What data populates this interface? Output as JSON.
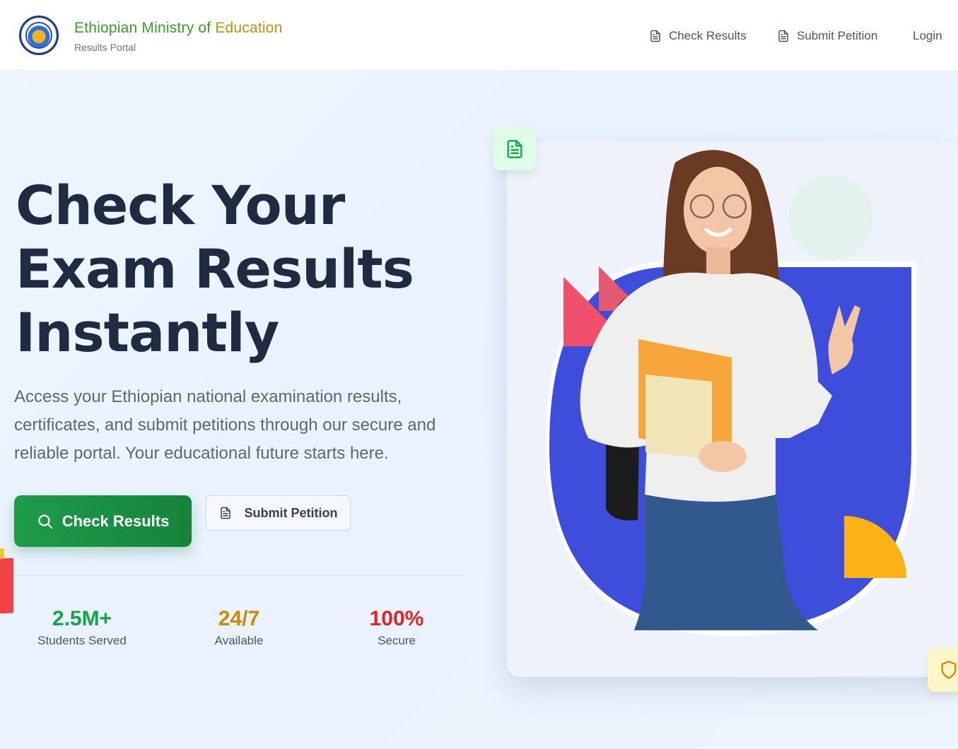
{
  "header": {
    "brand_title_main": "Ethiopian Ministry of",
    "brand_title_tail": " Education",
    "brand_subtitle": "Results Portal",
    "nav": {
      "check_results": "Check Results",
      "submit_petition": "Submit Petition",
      "login": "Login"
    }
  },
  "hero": {
    "title_lines": [
      "Check Your",
      "Exam Results",
      "Instantly"
    ],
    "description": "Access your Ethiopian national examination results, certificates, and submit petitions through our secure and reliable portal. Your educational future starts here.",
    "primary_button": "Check Results",
    "secondary_button": "Submit Petition"
  },
  "stats": [
    {
      "value": "2.5M+",
      "label": "Students Served",
      "color": "#16a34a"
    },
    {
      "value": "24/7",
      "label": "Available",
      "color": "#ca8a04"
    },
    {
      "value": "100%",
      "label": "Secure",
      "color": "#dc2626"
    }
  ],
  "colors": {
    "brand_green": "#3e9a2e",
    "brand_gold": "#b99118",
    "primary": "#1e9b4a",
    "illustration_blue": "#3f4ddb",
    "accent_red": "#f0506a",
    "accent_yellow": "#fbb216"
  },
  "icons": {
    "nav_check_results": "document-icon",
    "nav_submit_petition": "document-icon",
    "primary_button": "search-icon",
    "secondary_button": "document-icon",
    "card_badge_top": "document-icon",
    "card_badge_bottom": "shield-icon"
  }
}
